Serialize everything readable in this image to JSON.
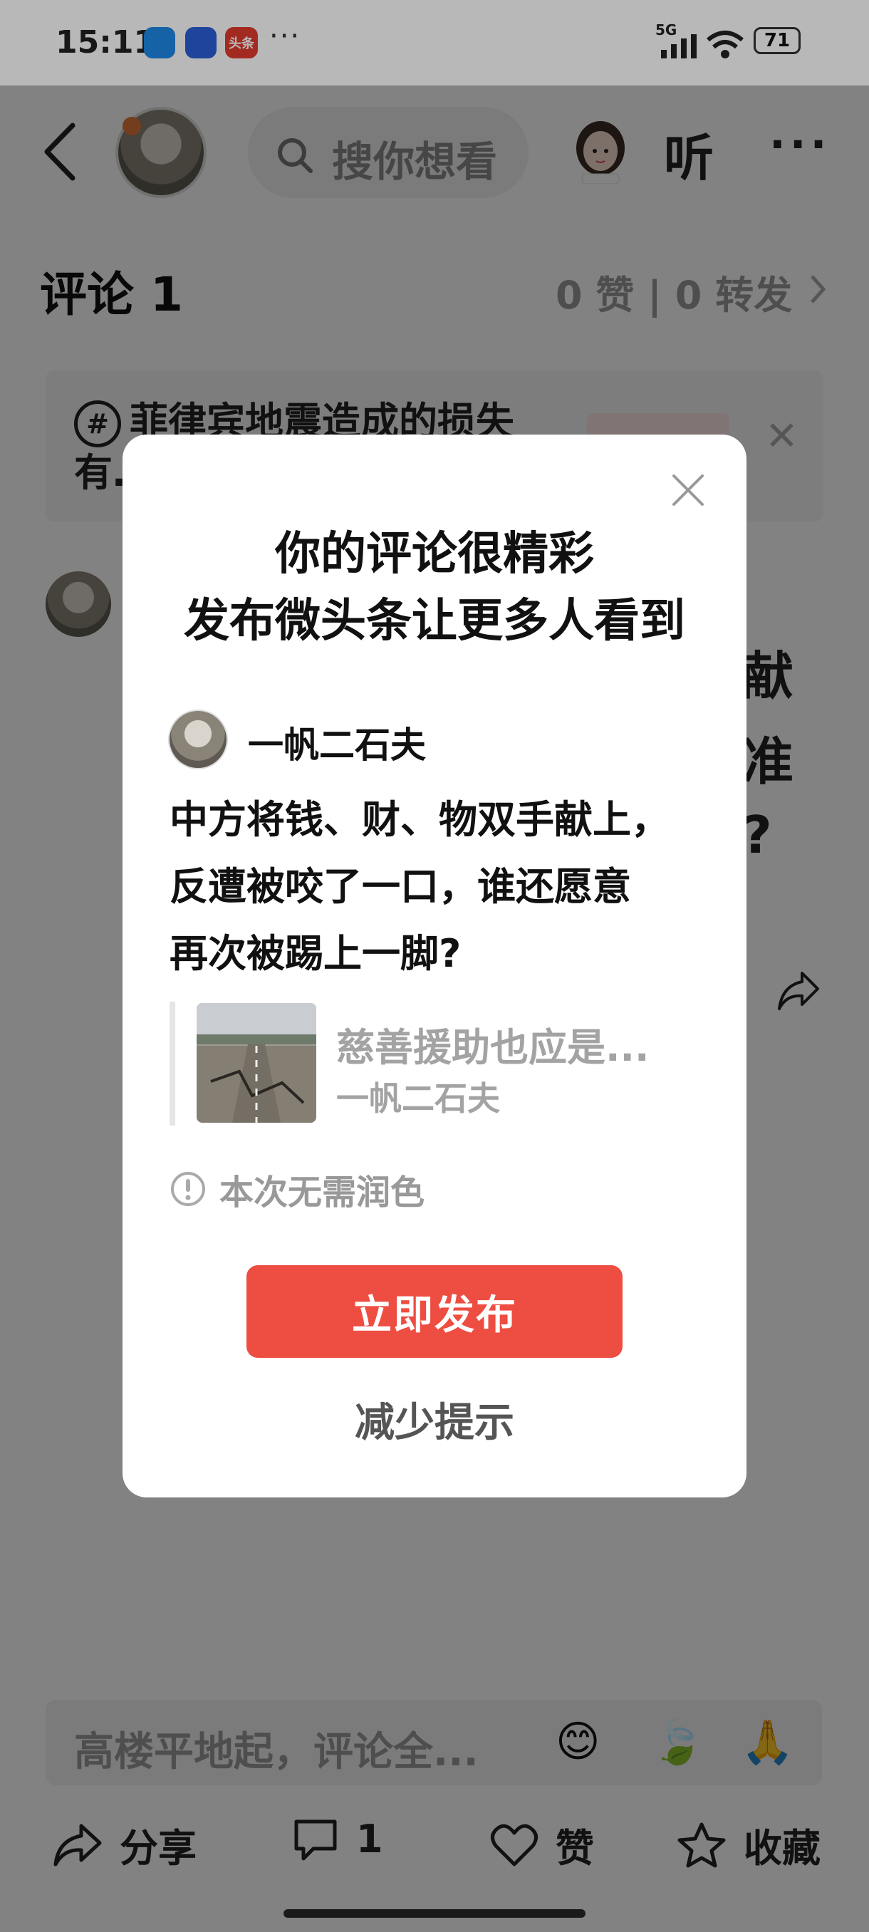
{
  "status_bar": {
    "time": "15:11",
    "network": "5G",
    "battery": "71",
    "more": "···",
    "app_badge_toutiao": "头条"
  },
  "header": {
    "search_placeholder": "搜你想看",
    "listen_label": "听",
    "more": "···"
  },
  "comments": {
    "title": "评论 1",
    "stats": "0 赞 | 0 转发"
  },
  "topic": {
    "line1": "菲律宾地震造成的损失",
    "line2": "有…"
  },
  "background_fragments": [
    "献",
    "准",
    "?"
  ],
  "dialog": {
    "title_line1": "你的评论很精彩",
    "title_line2": "发布微头条让更多人看到",
    "author": "一帆二石夫",
    "body_lines": [
      "中方将钱、财、物双手献上，",
      "反遭被咬了一口，谁还愿意",
      "再次被踢上一脚?"
    ],
    "quote_title": "慈善援助也应是...",
    "quote_author": "一帆二石夫",
    "notice": "本次无需润色",
    "publish_button": "立即发布",
    "less_button": "减少提示"
  },
  "bottom": {
    "input_placeholder": "高楼平地起，评论全...",
    "emojis": [
      "😊",
      "🍃",
      "🙏"
    ],
    "share": "分享",
    "comment_count": "1",
    "like": "赞",
    "collect": "收藏"
  },
  "colors": {
    "accent": "#ee4d41",
    "overlay": "rgba(0,0,0,0.49)"
  },
  "icons": [
    "back-arrow-icon",
    "search-icon",
    "share-icon",
    "comment-icon",
    "heart-icon",
    "star-icon",
    "close-icon",
    "info-icon"
  ]
}
